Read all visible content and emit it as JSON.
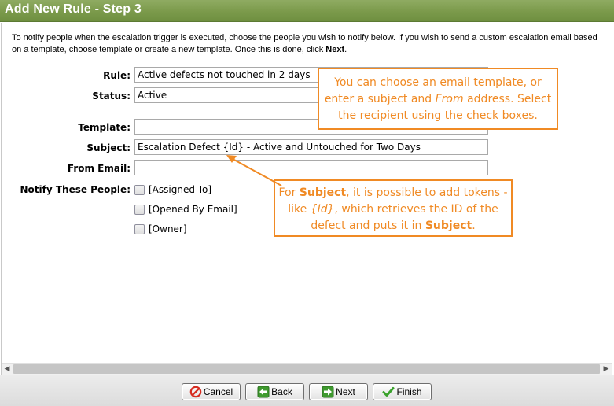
{
  "window": {
    "title": "Add New Rule - Step 3"
  },
  "intro": {
    "text": "To notify people when the escalation trigger is executed, choose the people you wish to notify below. If you wish to send a custom escalation email based on a template, choose template or create a new template. Once this is done, click ",
    "bold": "Next",
    "end": "."
  },
  "form": {
    "rule_label": "Rule:",
    "rule_value": "Active defects not touched in 2 days",
    "status_label": "Status:",
    "status_value": "Active",
    "template_label": "Template:",
    "template_value": "",
    "subject_label": "Subject:",
    "subject_value": "Escalation Defect {Id} - Active and Untouched for Two Days",
    "from_label": "From Email:",
    "from_value": "",
    "notify_label": "Notify These People:",
    "people": [
      "[Assigned To]",
      "[Opened By Email]",
      "[Owner]"
    ]
  },
  "callout1": {
    "line1": "You can choose an email template, or",
    "line2a": "enter a subject and ",
    "line2i": "From",
    "line2b": " address. Select",
    "line3": "the recipient using the check boxes."
  },
  "callout2": {
    "l1a": "For ",
    "l1b": "Subject",
    "l1c": ", it is possible to add tokens -",
    "l2a": "like ",
    "l2i": "{Id}",
    "l2b": ", which retrieves the ID of the",
    "l3a": "defect and puts it in ",
    "l3b": "Subject",
    "l3c": "."
  },
  "buttons": {
    "cancel": "Cancel",
    "back": "Back",
    "next": "Next",
    "finish": "Finish"
  },
  "colors": {
    "title_bar": "#7b9a4b",
    "callout": "#f08a24"
  }
}
